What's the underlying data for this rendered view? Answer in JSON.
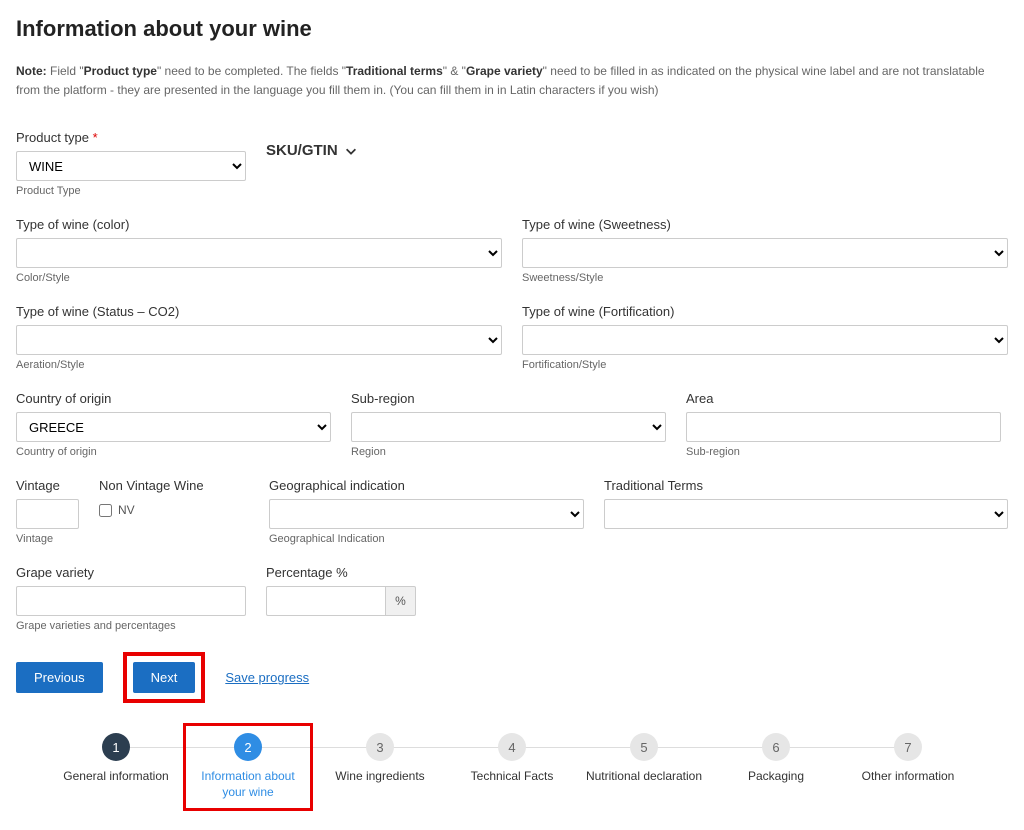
{
  "title": "Information about your wine",
  "note": {
    "prefix": "Note:",
    "t1": " Field \"",
    "b1": "Product type",
    "t2": "\" need to be completed. The fields \"",
    "b2": "Traditional terms",
    "t3": "\" & \"",
    "b3": "Grape variety",
    "t4": "\" need to be filled in as indicated on the physical wine label and are not translatable from the platform - they are presented in the language you fill them in. (You can fill them in in Latin characters if you wish)"
  },
  "product_type": {
    "label": "Product type",
    "value": "WINE",
    "helper": "Product Type"
  },
  "sku_gtin": "SKU/GTIN",
  "color": {
    "label": "Type of wine (color)",
    "helper": "Color/Style"
  },
  "sweetness": {
    "label": "Type of wine (Sweetness)",
    "helper": "Sweetness/Style"
  },
  "status_co2": {
    "label": "Type of wine (Status – CO2)",
    "helper": "Aeration/Style"
  },
  "fortification": {
    "label": "Type of wine (Fortification)",
    "helper": "Fortification/Style"
  },
  "country": {
    "label": "Country of origin",
    "value": "GREECE",
    "helper": "Country of origin"
  },
  "subregion": {
    "label": "Sub-region",
    "helper": "Region"
  },
  "area": {
    "label": "Area",
    "helper": "Sub-region"
  },
  "vintage": {
    "label": "Vintage",
    "helper": "Vintage"
  },
  "nv": {
    "label": "Non Vintage Wine",
    "checkbox": "NV"
  },
  "gi": {
    "label": "Geographical indication",
    "helper": "Geographical Indication"
  },
  "tt": {
    "label": "Traditional Terms"
  },
  "grape": {
    "label": "Grape variety",
    "helper": "Grape varieties and percentages"
  },
  "pct": {
    "label": "Percentage %",
    "addon": "%"
  },
  "actions": {
    "prev": "Previous",
    "next": "Next",
    "save": "Save progress"
  },
  "steps": [
    {
      "num": "1",
      "label": "General information"
    },
    {
      "num": "2",
      "label": "Information about your wine"
    },
    {
      "num": "3",
      "label": "Wine ingredients"
    },
    {
      "num": "4",
      "label": "Technical Facts"
    },
    {
      "num": "5",
      "label": "Nutritional declaration"
    },
    {
      "num": "6",
      "label": "Packaging"
    },
    {
      "num": "7",
      "label": "Other information"
    }
  ]
}
